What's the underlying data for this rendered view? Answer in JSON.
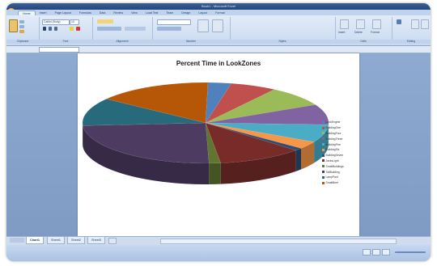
{
  "window": {
    "title": "Book1 - Microsoft Excel"
  },
  "ribbon": {
    "tabs": [
      "Home",
      "Insert",
      "Page Layout",
      "Formulas",
      "Data",
      "Review",
      "View",
      "Load Test",
      "Team",
      "Design",
      "Layout",
      "Format"
    ],
    "active_tab": "Home",
    "groups": [
      "Clipboard",
      "Font",
      "Alignment",
      "Number",
      "Styles",
      "Cells",
      "Editing"
    ],
    "font_name": "Calibri (Body)",
    "font_size": "10",
    "cells_buttons": [
      "Insert",
      "Delete",
      "Format"
    ]
  },
  "chart_data": {
    "type": "pie",
    "title": "Percent Time in LookZones",
    "categories": [
      "LookEngine",
      "BuildingOne",
      "BuildingFour",
      "BuildingThree",
      "BuildingFive",
      "BuildingSix",
      "BuildingSeven",
      "JacksLight",
      "SmallBuildings",
      "TallBuilding",
      "LampPost",
      "SmallBeer"
    ],
    "values": [
      3,
      6,
      8,
      8,
      7,
      3,
      1,
      11,
      1.5,
      24,
      11,
      15
    ],
    "colors": [
      "#4f81bd",
      "#c0504d",
      "#9bbb59",
      "#8064a2",
      "#4bacc6",
      "#f79646",
      "#2c4d75",
      "#772c2a",
      "#5f7530",
      "#4d3b62",
      "#276a7c",
      "#b65708"
    ]
  },
  "sheet_tabs": [
    "Chart1",
    "Sheet1",
    "Sheet2",
    "Sheet3"
  ],
  "active_sheet": "Chart1"
}
